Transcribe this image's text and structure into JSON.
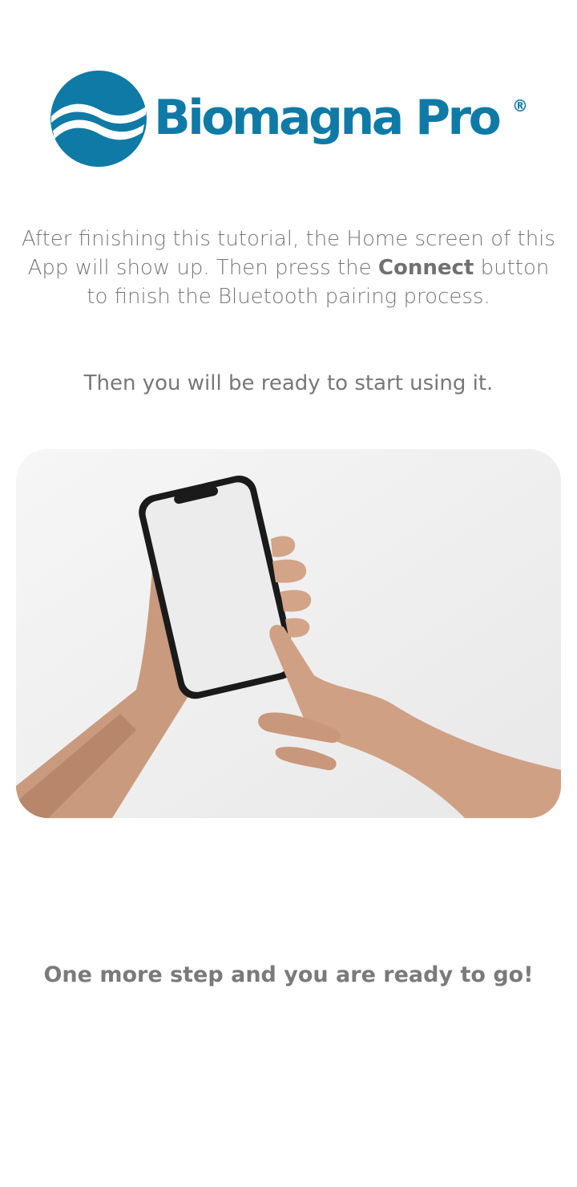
{
  "brand": {
    "name": "Biomagna Pro",
    "registered_mark": "®",
    "color": "#0f7aa6"
  },
  "intro": {
    "part1": "After finishing this tutorial, the Home screen of this App will show up. Then press the ",
    "highlight": "Connect",
    "part2": " button to finish the Bluetooth pairing process."
  },
  "ready_text": "Then you will be ready to start using it.",
  "illustration": {
    "icon": "hand-holding-phone-illustration"
  },
  "footer_message": "One more step and you are ready to go!",
  "colors": {
    "text": "#777777",
    "background": "#ffffff"
  }
}
